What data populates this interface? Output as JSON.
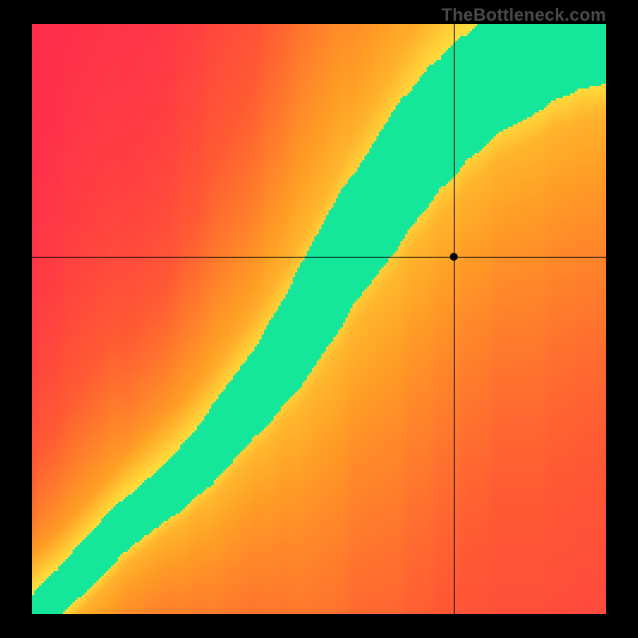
{
  "watermark": "TheBottleneck.com",
  "chart_data": {
    "type": "heatmap",
    "title": "",
    "xlabel": "",
    "ylabel": "",
    "xlim": [
      0,
      1
    ],
    "ylim": [
      0,
      1
    ],
    "crosshair": {
      "x": 0.735,
      "y": 0.605
    },
    "marker": {
      "x": 0.735,
      "y": 0.605
    },
    "colormap": {
      "stops": [
        {
          "t": 0.0,
          "color": "#ff2a4d"
        },
        {
          "t": 0.3,
          "color": "#ff5a33"
        },
        {
          "t": 0.55,
          "color": "#ff9d25"
        },
        {
          "t": 0.75,
          "color": "#ffd93a"
        },
        {
          "t": 0.88,
          "color": "#fff84a"
        },
        {
          "t": 0.985,
          "color": "#e6ff4a"
        },
        {
          "t": 1.0,
          "color": "#14e799"
        }
      ]
    },
    "ridge": {
      "description": "optimal-match curve where the heat value peaks; green band follows this curve",
      "points": [
        {
          "x": 0.0,
          "y": 0.0
        },
        {
          "x": 0.05,
          "y": 0.04
        },
        {
          "x": 0.1,
          "y": 0.09
        },
        {
          "x": 0.15,
          "y": 0.14
        },
        {
          "x": 0.2,
          "y": 0.18
        },
        {
          "x": 0.25,
          "y": 0.22
        },
        {
          "x": 0.3,
          "y": 0.27
        },
        {
          "x": 0.35,
          "y": 0.33
        },
        {
          "x": 0.4,
          "y": 0.39
        },
        {
          "x": 0.45,
          "y": 0.46
        },
        {
          "x": 0.5,
          "y": 0.54
        },
        {
          "x": 0.55,
          "y": 0.62
        },
        {
          "x": 0.6,
          "y": 0.69
        },
        {
          "x": 0.65,
          "y": 0.76
        },
        {
          "x": 0.7,
          "y": 0.82
        },
        {
          "x": 0.75,
          "y": 0.87
        },
        {
          "x": 0.8,
          "y": 0.91
        },
        {
          "x": 0.85,
          "y": 0.94
        },
        {
          "x": 0.9,
          "y": 0.97
        },
        {
          "x": 0.95,
          "y": 0.99
        },
        {
          "x": 1.0,
          "y": 1.0
        }
      ],
      "half_width_base": 0.03,
      "half_width_peak": 0.1
    }
  }
}
